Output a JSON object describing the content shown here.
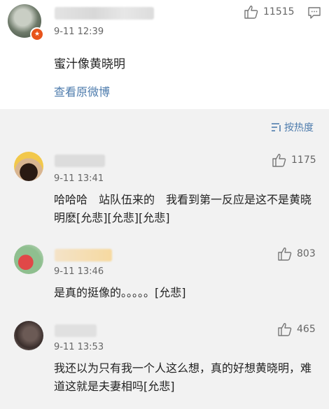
{
  "post": {
    "time": "9-11 12:39",
    "likes": "11515",
    "text": "蜜汁像黄晓明",
    "link": "查看原微博"
  },
  "sort_label": "按热度",
  "comments": [
    {
      "time": "9-11 13:41",
      "likes": "1175",
      "text": "哈哈哈　站队伍来的　我看到第一反应是这不是黄晓明麽[允悲][允悲][允悲]"
    },
    {
      "time": "9-11 13:46",
      "likes": "803",
      "text": "是真的挺像的。。。。。[允悲]"
    },
    {
      "time": "9-11 13:53",
      "likes": "465",
      "text": "我还以为只有我一个人这么想，真的好想黄晓明，难道这就是夫妻相吗[允悲]"
    }
  ]
}
